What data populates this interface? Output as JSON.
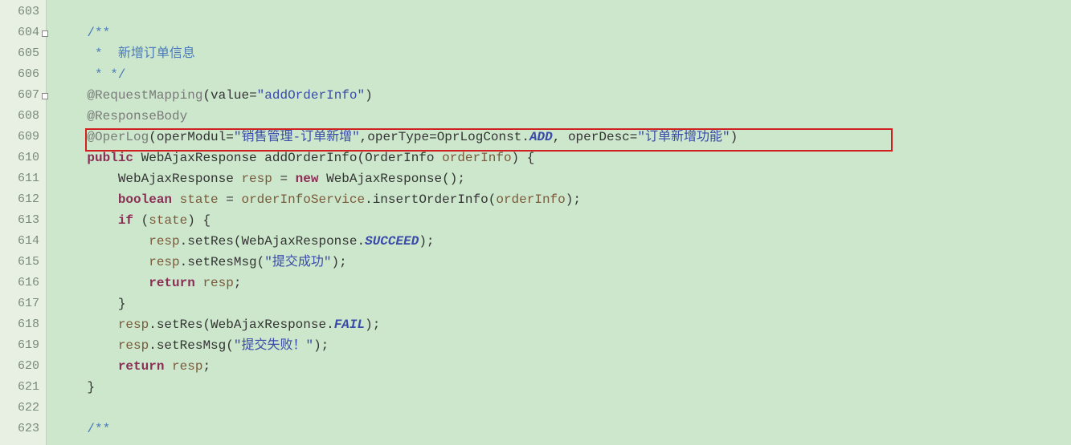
{
  "lines": {
    "start": 603,
    "numbers": [
      "603",
      "604",
      "605",
      "606",
      "607",
      "608",
      "609",
      "610",
      "611",
      "612",
      "613",
      "614",
      "615",
      "616",
      "617",
      "618",
      "619",
      "620",
      "621",
      "622",
      "623"
    ],
    "fold_lines": [
      604,
      607
    ]
  },
  "code": {
    "l603": "",
    "l604_comment_open": "/**",
    "l605_comment": " *  新增订单信息",
    "l606_comment_close": " * */",
    "l607_annotation": "@RequestMapping",
    "l607_attr": "value",
    "l607_eq": "=",
    "l607_string": "\"addOrderInfo\"",
    "l608_annotation": "@ResponseBody",
    "l609_annotation": "@OperLog",
    "l609_a1": "operModul",
    "l609_s1": "\"销售管理-订单新增\"",
    "l609_a2": "operType",
    "l609_v2a": "OprLogConst",
    "l609_v2b": "ADD",
    "l609_a3": "operDesc",
    "l609_s3": "\"订单新增功能\"",
    "l610_kw1": "public",
    "l610_type": "WebAjaxResponse",
    "l610_method": "addOrderInfo",
    "l610_ptype": "OrderInfo",
    "l610_pname": "orderInfo",
    "l611_type": "WebAjaxResponse",
    "l611_var": "resp",
    "l611_kw": "new",
    "l611_ctor": "WebAjaxResponse",
    "l612_kw": "boolean",
    "l612_var": "state",
    "l612_svc": "orderInfoService",
    "l612_method": "insertOrderInfo",
    "l612_arg": "orderInfo",
    "l613_kw": "if",
    "l613_cond": "state",
    "l614_obj": "resp",
    "l614_method": "setRes",
    "l614_cls": "WebAjaxResponse",
    "l614_field": "SUCCEED",
    "l615_obj": "resp",
    "l615_method": "setResMsg",
    "l615_str": "\"提交成功\"",
    "l616_kw": "return",
    "l616_var": "resp",
    "l618_obj": "resp",
    "l618_method": "setRes",
    "l618_cls": "WebAjaxResponse",
    "l618_field": "FAIL",
    "l619_obj": "resp",
    "l619_method": "setResMsg",
    "l619_str": "\"提交失败！\"",
    "l620_kw": "return",
    "l620_var": "resp",
    "l623_comment": "/**"
  }
}
